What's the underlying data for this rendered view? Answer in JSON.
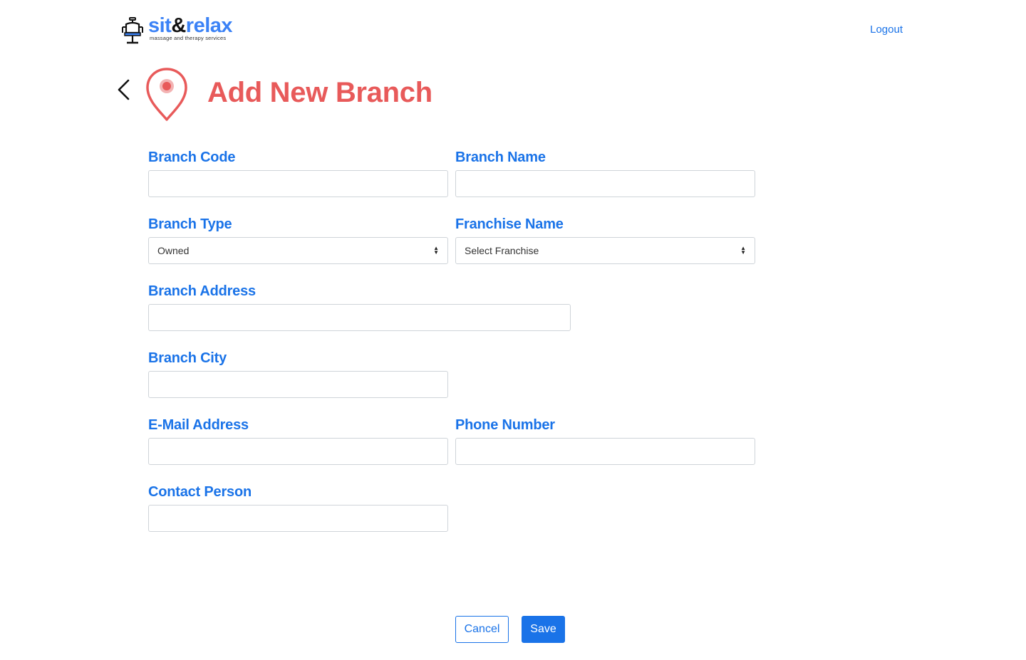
{
  "header": {
    "brand_part1": "sit",
    "brand_amp": "&",
    "brand_part2": "relax",
    "tagline": "massage and therapy services",
    "logout_label": "Logout"
  },
  "page": {
    "title": "Add New Branch",
    "back_icon": "chevron-left-icon",
    "title_icon": "map-pin-icon"
  },
  "form": {
    "branch_code": {
      "label": "Branch Code",
      "value": ""
    },
    "branch_name": {
      "label": "Branch Name",
      "value": ""
    },
    "branch_type": {
      "label": "Branch Type",
      "selected": "Owned"
    },
    "franchise_name": {
      "label": "Franchise Name",
      "selected": "Select Franchise"
    },
    "branch_address": {
      "label": "Branch Address",
      "value": ""
    },
    "branch_city": {
      "label": "Branch City",
      "value": ""
    },
    "email": {
      "label": "E-Mail Address",
      "value": ""
    },
    "phone": {
      "label": "Phone Number",
      "value": ""
    },
    "contact_person": {
      "label": "Contact Person",
      "value": ""
    }
  },
  "actions": {
    "cancel_label": "Cancel",
    "save_label": "Save"
  },
  "colors": {
    "brand_blue": "#3b82f6",
    "link_blue": "#1a73e8",
    "title_red": "#e85a5a"
  }
}
